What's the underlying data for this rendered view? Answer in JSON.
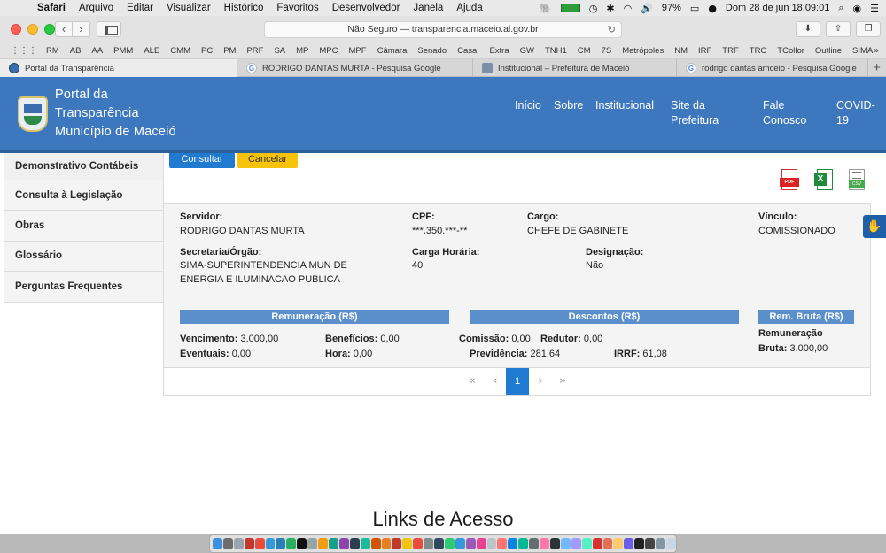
{
  "menubar": {
    "app": "Safari",
    "items": [
      "Arquivo",
      "Editar",
      "Visualizar",
      "Histórico",
      "Favoritos",
      "Desenvolvedor",
      "Janela",
      "Ajuda"
    ],
    "battery": "97%",
    "datetime": "Dom 28 de jun  18:09:01"
  },
  "browser": {
    "url": "Não Seguro — transparencia.maceio.al.gov.br",
    "bookmarks": [
      "RM",
      "AB",
      "AA",
      "PMM",
      "ALE",
      "CMM",
      "PC",
      "PM",
      "PRF",
      "SA",
      "MP",
      "MPC",
      "MPF",
      "Câmara",
      "Senado",
      "Casal",
      "Extra",
      "GW",
      "TNH1",
      "CM",
      "7S",
      "Metrópoles",
      "NM",
      "IRF",
      "TRF",
      "TRC",
      "TCollor",
      "Outline",
      "SIMA"
    ],
    "tabs": [
      {
        "title": "Portal da Transparência",
        "active": true
      },
      {
        "title": "RODRIGO DANTAS MURTA - Pesquisa Google",
        "active": false
      },
      {
        "title": "Institucional – Prefeitura de Maceió",
        "active": false
      },
      {
        "title": "rodrigo dantas amceio - Pesquisa Google",
        "active": false
      }
    ]
  },
  "header": {
    "brand_line1": "Portal da",
    "brand_line2": "Transparência",
    "brand_line3": "Município de Maceió",
    "nav": {
      "inicio": "Início",
      "sobre": "Sobre",
      "institucional": "Institucional",
      "site_line1": "Site da",
      "site_line2": "Prefeitura",
      "fale_line1": "Fale",
      "fale_line2": "Conosco",
      "covid_line1": "COVID-",
      "covid_line2": "19"
    },
    "bg_color": "#3d78be"
  },
  "sidebar": {
    "items": [
      "Demonstrativo Contábeis",
      "Consulta à Legislação",
      "Obras",
      "Glossário",
      "Perguntas Frequentes"
    ]
  },
  "actions": {
    "consultar": "Consultar",
    "cancelar": "Cancelar"
  },
  "export": {
    "pdf_label": "PDF",
    "xls_label": "X",
    "csv_label": "CSV"
  },
  "servidor": {
    "servidor_label": "Servidor:",
    "servidor_value": "RODRIGO DANTAS MURTA",
    "cpf_label": "CPF:",
    "cpf_value": "***.350.***-**",
    "cargo_label": "Cargo:",
    "cargo_value": "CHEFE DE GABINETE",
    "vinculo_label": "Vínculo:",
    "vinculo_value": "COMISSIONADO",
    "secretaria_label": "Secretaria/Órgão:",
    "secretaria_line1": "SIMA-SUPERINTENDENCIA MUN DE",
    "secretaria_line2": "ENERGIA E ILUMINACAO PUBLICA",
    "carga_label": "Carga Horária:",
    "carga_value": "40",
    "designacao_label": "Designação:",
    "designacao_value": "Não"
  },
  "remuneracao": {
    "title": "Remuneração (R$)",
    "vencimento_label": "Vencimento:",
    "vencimento_value": "3.000,00",
    "beneficios_label": "Benefícios:",
    "beneficios_value": "0,00",
    "eventuais_label": "Eventuais:",
    "eventuais_value": "0,00",
    "hora_label": "Hora:",
    "hora_value": "0,00"
  },
  "descontos": {
    "title": "Descontos (R$)",
    "comissao_label": "Comissão:",
    "comissao_value": "0,00",
    "redutor_label": "Redutor:",
    "redutor_value": "0,00",
    "previdencia_label": "Previdência:",
    "previdencia_value": "281,64",
    "irrf_label": "IRRF:",
    "irrf_value": "61,08"
  },
  "rem_bruta": {
    "title": "Rem. Bruta (R$)",
    "remuneracao_label": "Remuneração",
    "bruta_label": "Bruta:",
    "bruta_value": "3.000,00"
  },
  "pagination": {
    "first": "«",
    "prev": "‹",
    "current": "1",
    "next": "›",
    "last": "»"
  },
  "footer": {
    "links_title": "Links de Acesso"
  },
  "colors": {
    "primary": "#1f7ad0",
    "warning": "#f7c20a",
    "section_bar": "#5a8fcb"
  }
}
